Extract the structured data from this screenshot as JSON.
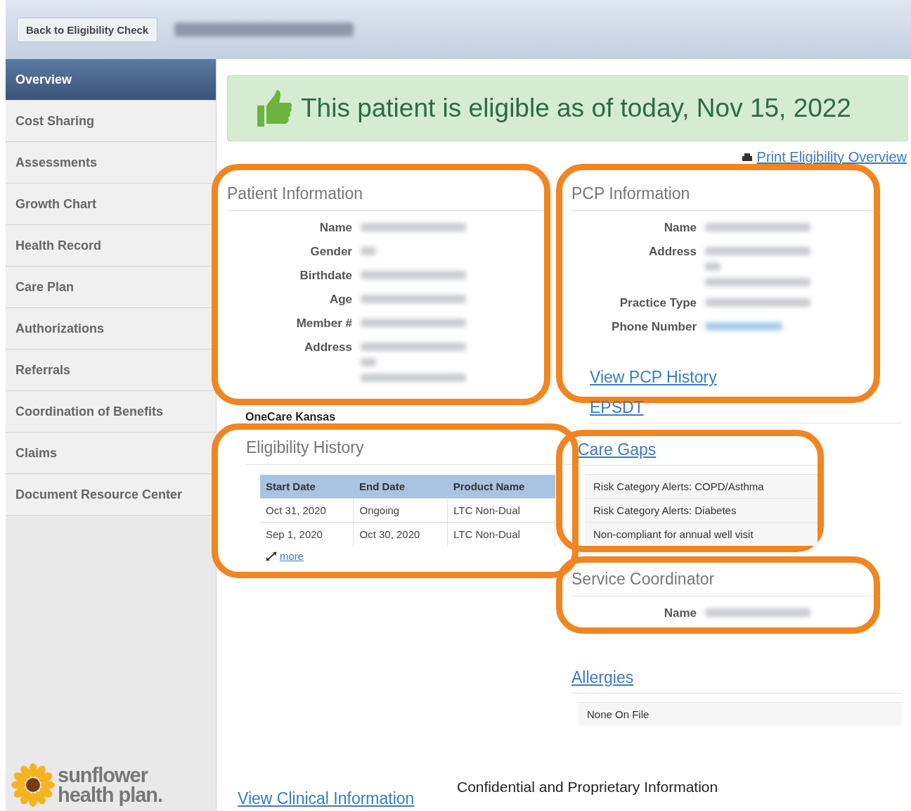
{
  "header": {
    "back_button": "Back to Eligibility Check"
  },
  "sidebar": {
    "items": [
      {
        "label": "Overview",
        "selected": true
      },
      {
        "label": "Cost Sharing",
        "selected": false
      },
      {
        "label": "Assessments",
        "selected": false
      },
      {
        "label": "Growth Chart",
        "selected": false
      },
      {
        "label": "Health Record",
        "selected": false
      },
      {
        "label": "Care Plan",
        "selected": false
      },
      {
        "label": "Authorizations",
        "selected": false
      },
      {
        "label": "Referrals",
        "selected": false
      },
      {
        "label": "Coordination of Benefits",
        "selected": false
      },
      {
        "label": "Claims",
        "selected": false
      },
      {
        "label": "Document Resource Center",
        "selected": false
      }
    ]
  },
  "logo": {
    "line1": "sunflower",
    "line2": "health plan."
  },
  "banner": {
    "text": "This patient is eligible as of today, Nov 15, 2022"
  },
  "print_link": "Print Eligibility Overview",
  "patient_info": {
    "title": "Patient Information",
    "highlighted": true,
    "fields": [
      {
        "label": "Name",
        "kind": "blurred"
      },
      {
        "label": "Gender",
        "kind": "blurred_tiny"
      },
      {
        "label": "Birthdate",
        "kind": "blurred"
      },
      {
        "label": "Age",
        "kind": "blurred"
      },
      {
        "label": "Member #",
        "kind": "blurred"
      },
      {
        "label": "Address",
        "kind": "blurred_multiline"
      }
    ]
  },
  "plan_name": "OneCare Kansas",
  "eligibility_history": {
    "title": "Eligibility History",
    "highlighted": true,
    "columns": [
      "Start Date",
      "End Date",
      "Product Name"
    ],
    "rows": [
      [
        "Oct 31, 2020",
        "Ongoing",
        "LTC Non-Dual"
      ],
      [
        "Sep 1, 2020",
        "Oct 30, 2020",
        "LTC Non-Dual"
      ]
    ],
    "more_link": "more"
  },
  "pcp": {
    "title": "PCP Information",
    "highlighted": true,
    "fields": [
      {
        "label": "Name",
        "kind": "blurred"
      },
      {
        "label": "Address",
        "kind": "blurred_multiline"
      },
      {
        "label": "Practice Type",
        "kind": "blurred"
      },
      {
        "label": "Phone Number",
        "kind": "blurred_link"
      }
    ],
    "history_link": "View PCP History"
  },
  "epsdt": {
    "title": "EPSDT",
    "highlighted": false
  },
  "care_gaps": {
    "title": "Care Gaps",
    "highlighted": true,
    "items": [
      "Risk Category Alerts: COPD/Asthma",
      "Risk Category Alerts: Diabetes",
      "Non-compliant for annual well visit"
    ]
  },
  "service_coordinator": {
    "title": "Service Coordinator",
    "highlighted": true,
    "fields": [
      {
        "label": "Name",
        "kind": "blurred"
      }
    ]
  },
  "allergies": {
    "title": "Allergies",
    "highlighted": false,
    "items": [
      "None On File"
    ]
  },
  "clinical_link": "View Clinical Information",
  "footer_note": "Confidential and Proprietary Information"
}
